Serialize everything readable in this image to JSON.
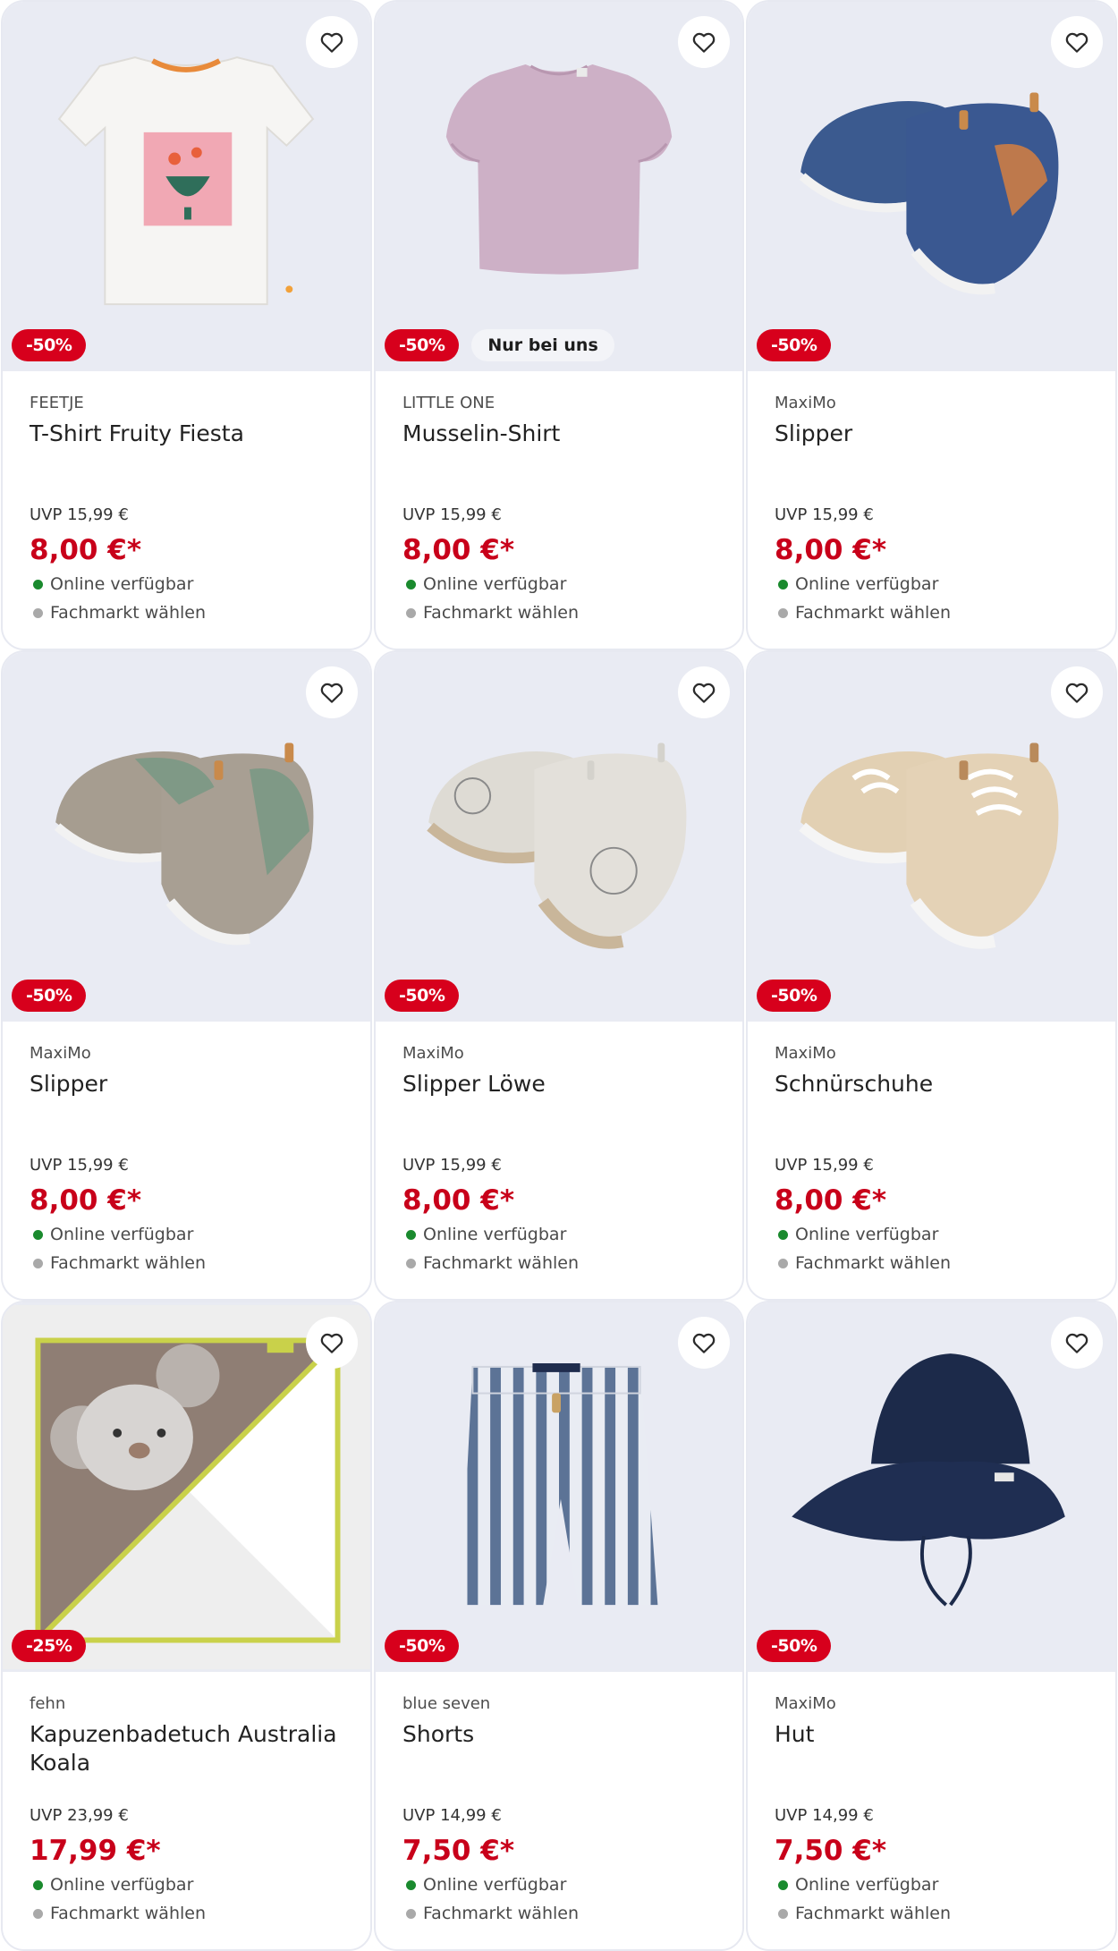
{
  "colors": {
    "discount_badge": "#d7001c",
    "price": "#c8001a",
    "online_dot": "#1a8a2e",
    "store_dot": "#a9a9a9",
    "image_background": "#e9ebf3"
  },
  "products": [
    {
      "image": "tshirt-fruity-fiesta",
      "discount": "-50%",
      "exclusive_badge": "",
      "brand": "FEETJE",
      "title": "T-Shirt Fruity Fiesta",
      "uvp": "UVP 15,99 €",
      "price": "8,00 €*",
      "online": "Online verfügbar",
      "store": "Fachmarkt wählen"
    },
    {
      "image": "musselin-shirt",
      "discount": "-50%",
      "exclusive_badge": "Nur bei uns",
      "brand": "LITTLE ONE",
      "title": "Musselin-Shirt",
      "uvp": "UVP 15,99 €",
      "price": "8,00 €*",
      "online": "Online verfügbar",
      "store": "Fachmarkt wählen"
    },
    {
      "image": "slipper-blue",
      "discount": "-50%",
      "exclusive_badge": "",
      "brand": "MaxiMo",
      "title": "Slipper",
      "uvp": "UVP 15,99 €",
      "price": "8,00 €*",
      "online": "Online verfügbar",
      "store": "Fachmarkt wählen"
    },
    {
      "image": "slipper-grey-green",
      "discount": "-50%",
      "exclusive_badge": "",
      "brand": "MaxiMo",
      "title": "Slipper",
      "uvp": "UVP 15,99 €",
      "price": "8,00 €*",
      "online": "Online verfügbar",
      "store": "Fachmarkt wählen"
    },
    {
      "image": "slipper-loewe",
      "discount": "-50%",
      "exclusive_badge": "",
      "brand": "MaxiMo",
      "title": "Slipper Löwe",
      "uvp": "UVP 15,99 €",
      "price": "8,00 €*",
      "online": "Online verfügbar",
      "store": "Fachmarkt wählen"
    },
    {
      "image": "schnuerschuhe",
      "discount": "-50%",
      "exclusive_badge": "",
      "brand": "MaxiMo",
      "title": "Schnürschuhe",
      "uvp": "UVP 15,99 €",
      "price": "8,00 €*",
      "online": "Online verfügbar",
      "store": "Fachmarkt wählen"
    },
    {
      "image": "kapuzenbadetuch-koala",
      "discount": "-25%",
      "exclusive_badge": "",
      "brand": "fehn",
      "title": "Kapuzenbadetuch Australia Koala",
      "uvp": "UVP 23,99 €",
      "price": "17,99 €*",
      "online": "Online verfügbar",
      "store": "Fachmarkt wählen"
    },
    {
      "image": "shorts-striped",
      "discount": "-50%",
      "exclusive_badge": "",
      "brand": "blue seven",
      "title": "Shorts",
      "uvp": "UVP 14,99 €",
      "price": "7,50 €*",
      "online": "Online verfügbar",
      "store": "Fachmarkt wählen"
    },
    {
      "image": "hut-navy",
      "discount": "-50%",
      "exclusive_badge": "",
      "brand": "MaxiMo",
      "title": "Hut",
      "uvp": "UVP 14,99 €",
      "price": "7,50 €*",
      "online": "Online verfügbar",
      "store": "Fachmarkt wählen"
    }
  ]
}
